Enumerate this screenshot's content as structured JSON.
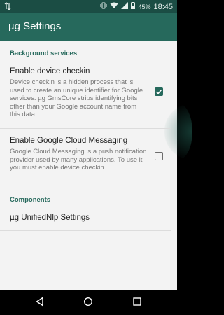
{
  "status_bar": {
    "battery_percent": "45%",
    "time": "18:45",
    "icons": [
      "sync-icon",
      "vibrate-icon",
      "wifi-icon",
      "signal-icon",
      "battery-icon"
    ]
  },
  "app_bar": {
    "title": "µg Settings"
  },
  "sections": {
    "background": {
      "header": "Background services"
    },
    "components": {
      "header": "Components"
    }
  },
  "prefs": {
    "device_checkin": {
      "title": "Enable device checkin",
      "summary": "Device checkin is a hidden process that is used to create an unique identifier for Google services. µg GmsCore strips identifying bits other than your Google account name from this data.",
      "checked": true
    },
    "gcm": {
      "title": "Enable Google Cloud Messaging",
      "summary": "Google Cloud Messaging is a push notification provider used by many applications. To use it you must enable device checkin.",
      "checked": false
    },
    "unifiednlp": {
      "title": "µg UnifiedNlp Settings"
    }
  },
  "colors": {
    "accent": "#26695c",
    "status_bar": "#1b4d44",
    "background": "#f3f3f3"
  },
  "nav_bar": {
    "icons": [
      "back-icon",
      "home-icon",
      "recents-icon"
    ]
  }
}
